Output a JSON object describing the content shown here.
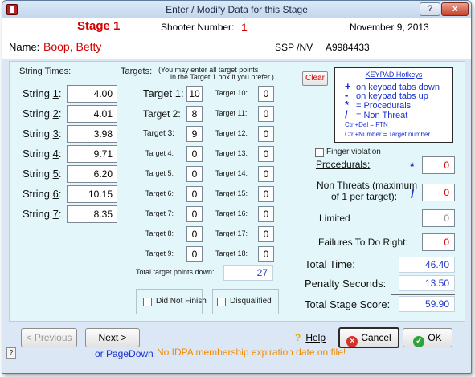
{
  "window": {
    "title": "Enter / Modify Data for this Stage",
    "help_label": "?",
    "close_label": "x"
  },
  "header": {
    "stage": "Stage 1",
    "shooter_label": "Shooter Number:",
    "shooter_number": "1",
    "date": "November  9, 2013",
    "name_label": "Name:",
    "name_value": "Boop, Betty",
    "division": "SSP /NV",
    "member_id": "A9984433"
  },
  "strings": {
    "heading": "String Times:",
    "items": [
      {
        "prefix": "String ",
        "key": "1",
        "suffix": ":",
        "value": "4.00"
      },
      {
        "prefix": "String ",
        "key": "2",
        "suffix": ":",
        "value": "4.01"
      },
      {
        "prefix": "String ",
        "key": "3",
        "suffix": ":",
        "value": "3.98"
      },
      {
        "prefix": "String ",
        "key": "4",
        "suffix": ":",
        "value": "9.71"
      },
      {
        "prefix": "String ",
        "key": "5",
        "suffix": ":",
        "value": "6.20"
      },
      {
        "prefix": "String ",
        "key": "6",
        "suffix": ":",
        "value": "10.15"
      },
      {
        "prefix": "String ",
        "key": "7",
        "suffix": ":",
        "value": "8.35"
      }
    ]
  },
  "targets": {
    "heading": "Targets:",
    "note_line1": "(You may enter all target points",
    "note_line2": "in the Target 1 box if you prefer.)",
    "items": [
      {
        "label": "Target 1:",
        "value": "10"
      },
      {
        "label": "Target 2:",
        "value": "8"
      },
      {
        "label": "Target 3:",
        "value": "9"
      },
      {
        "label": "Target 4:",
        "value": "0"
      },
      {
        "label": "Target 5:",
        "value": "0"
      },
      {
        "label": "Target 6:",
        "value": "0"
      },
      {
        "label": "Target 7:",
        "value": "0"
      },
      {
        "label": "Target 8:",
        "value": "0"
      },
      {
        "label": "Target 9:",
        "value": "0"
      },
      {
        "label": "Target 10:",
        "value": "0"
      },
      {
        "label": "Target 11:",
        "value": "0"
      },
      {
        "label": "Target 12:",
        "value": "0"
      },
      {
        "label": "Target 13:",
        "value": "0"
      },
      {
        "label": "Target 14:",
        "value": "0"
      },
      {
        "label": "Target 15:",
        "value": "0"
      },
      {
        "label": "Target 16:",
        "value": "0"
      },
      {
        "label": "Target 17:",
        "value": "0"
      },
      {
        "label": "Target 18:",
        "value": "0"
      }
    ],
    "total_label": "Total target points down:",
    "total_value": "27"
  },
  "checkboxes": {
    "did_not_finish": "Did Not Finish",
    "disqualified": "Disqualified",
    "finger_violation": "Finger violation"
  },
  "clear_label": "Clear",
  "keypad": {
    "title": "KEYPAD Hotkeys",
    "rows": [
      {
        "sym": "+",
        "text": "on keypad tabs down"
      },
      {
        "sym": "-",
        "text": "on keypad tabs up"
      },
      {
        "sym": "*",
        "text": "= Procedurals"
      },
      {
        "sym": "/",
        "text": "= Non Threat"
      }
    ],
    "ctrl_del": "Ctrl+Del = FTN",
    "ctrl_num": "Ctrl+Number = Target number"
  },
  "penalties": {
    "procedurals_label": "Procedurals:",
    "procedurals_symbol": "*",
    "procedurals_value": "0",
    "non_threats_label1": "Non Threats (maximum",
    "non_threats_label2": "of 1 per target):",
    "non_threats_symbol": "/",
    "non_threats_value": "0",
    "limited_label": "Limited",
    "limited_value": "0",
    "ftdr_label": "Failures To Do Right:",
    "ftdr_value": "0"
  },
  "totals": {
    "total_time_label": "Total Time:",
    "total_time_value": "46.40",
    "penalty_label": "Penalty Seconds:",
    "penalty_value": "13.50",
    "stage_score_label": "Total Stage Score:",
    "stage_score_value": "59.90"
  },
  "footer": {
    "previous": "< Previous",
    "next": "Next >",
    "pagedown": "or PageDown",
    "warning": "No IDPA membership expiration date on file!",
    "help": "Help",
    "cancel": "Cancel",
    "ok": "OK",
    "small_q": "?"
  },
  "colors": {
    "accent_red": "#d40000",
    "link_blue": "#1a2fd0",
    "warning_orange": "#f28b00",
    "panel_bg": "#e3f7fb"
  }
}
